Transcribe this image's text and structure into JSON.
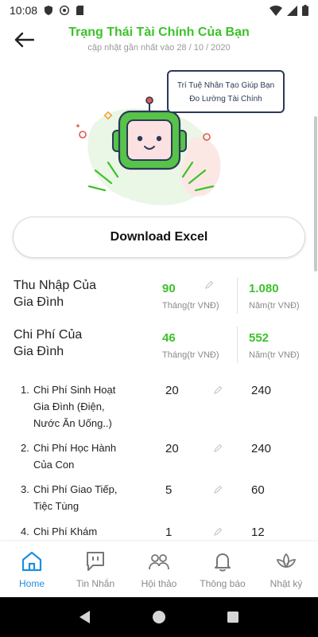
{
  "status_bar": {
    "time": "10:08"
  },
  "header": {
    "title": "Trạng Thái Tài Chính Của Bạn",
    "subtitle": "cập nhật gần nhất vào 28 / 10 / 2020"
  },
  "hero": {
    "speech_line1": "Trí Tuệ Nhân Tạo Giúp Bạn",
    "speech_line2": "Đo Lường Tài Chính"
  },
  "download_label": "Download Excel",
  "income": {
    "label_line1": "Thu Nhập Của",
    "label_line2": "Gia Đình",
    "monthly": "90",
    "monthly_unit": "Tháng(tr VNĐ)",
    "yearly": "1.080",
    "yearly_unit": "Năm(tr VNĐ)"
  },
  "expense": {
    "label_line1": "Chi Phí Của",
    "label_line2": "Gia Đình",
    "monthly": "46",
    "monthly_unit": "Tháng(tr VNĐ)",
    "yearly": "552",
    "yearly_unit": "Năm(tr VNĐ)"
  },
  "items": [
    {
      "num": "1.",
      "lines": [
        "Chi Phí Sinh Hoạt",
        "Gia Đình (Điện,",
        "Nước Ăn Uống..)"
      ],
      "monthly": "20",
      "yearly": "240"
    },
    {
      "num": "2.",
      "lines": [
        "Chi Phí Học Hành",
        "Của Con"
      ],
      "monthly": "20",
      "yearly": "240"
    },
    {
      "num": "3.",
      "lines": [
        "Chi Phí Giao Tiếp,",
        "Tiệc Tùng"
      ],
      "monthly": "5",
      "yearly": "60"
    },
    {
      "num": "4.",
      "lines": [
        "Chi Phí Khám"
      ],
      "monthly": "1",
      "yearly": "12"
    }
  ],
  "nav": {
    "home": "Home",
    "messages": "Tin Nhắn",
    "seminar": "Hội thảo",
    "notifications": "Thông báo",
    "diary": "Nhật ký"
  },
  "colors": {
    "accent_green": "#3cc22a",
    "active_blue": "#1e8fe0",
    "robot_border": "#2b3a55"
  }
}
